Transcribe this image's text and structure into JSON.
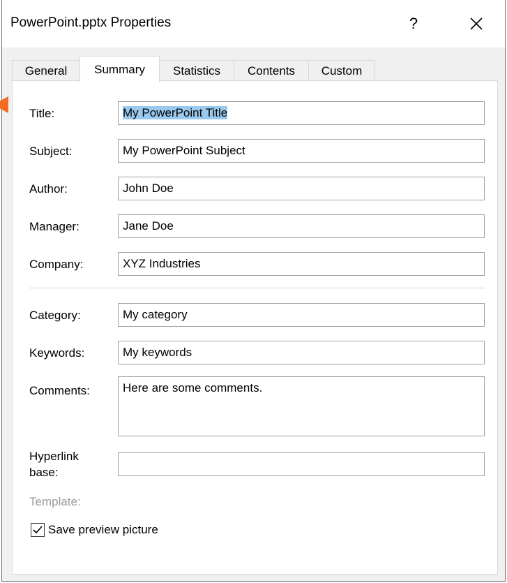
{
  "window": {
    "title": "PowerPoint.pptx Properties",
    "help_label": "?",
    "close_label": "✕"
  },
  "tabs": [
    {
      "label": "General",
      "active": false
    },
    {
      "label": "Summary",
      "active": true
    },
    {
      "label": "Statistics",
      "active": false
    },
    {
      "label": "Contents",
      "active": false
    },
    {
      "label": "Custom",
      "active": false
    }
  ],
  "summary": {
    "title": {
      "label": "Title:",
      "value": "My PowerPoint Title"
    },
    "subject": {
      "label": "Subject:",
      "value": "My PowerPoint Subject"
    },
    "author": {
      "label": "Author:",
      "value": "John Doe"
    },
    "manager": {
      "label": "Manager:",
      "value": "Jane Doe"
    },
    "company": {
      "label": "Company:",
      "value": "XYZ Industries"
    },
    "category": {
      "label": "Category:",
      "value": "My category"
    },
    "keywords": {
      "label": "Keywords:",
      "value": "My keywords"
    },
    "comments": {
      "label": "Comments:",
      "value": "Here are some comments."
    },
    "hyperlink_base": {
      "label_line1": "Hyperlink",
      "label_line2": "base:",
      "value": ""
    },
    "template": {
      "label": "Template:"
    },
    "save_preview": {
      "label": "Save preview picture",
      "checked": true
    }
  },
  "colors": {
    "accent_arrow": "#f26b21",
    "selection": "#99c9ef"
  }
}
